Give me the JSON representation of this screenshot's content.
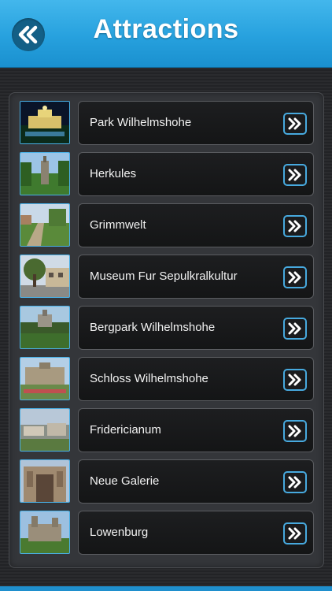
{
  "header": {
    "title": "Attractions",
    "back_icon": "double-chevron-left-icon"
  },
  "colors": {
    "header_top": "#43b7ec",
    "header_bottom": "#1a90cf",
    "accent": "#47a9de",
    "row_bg": "#17181a",
    "text": "#f2f2f2"
  },
  "items": [
    {
      "label": "Park Wilhelmshohe",
      "icon": "double-chevron-right-icon",
      "thumb": "night-palace"
    },
    {
      "label": "Herkules",
      "icon": "double-chevron-right-icon",
      "thumb": "statue-hill"
    },
    {
      "label": "Grimmwelt",
      "icon": "double-chevron-right-icon",
      "thumb": "path-lawn"
    },
    {
      "label": "Museum Fur Sepulkralkultur",
      "icon": "double-chevron-right-icon",
      "thumb": "tree-building"
    },
    {
      "label": "Bergpark Wilhelmshohe",
      "icon": "double-chevron-right-icon",
      "thumb": "castle-park"
    },
    {
      "label": "Schloss Wilhelmshohe",
      "icon": "double-chevron-right-icon",
      "thumb": "palace-garden"
    },
    {
      "label": "Fridericianum",
      "icon": "double-chevron-right-icon",
      "thumb": "city-aerial"
    },
    {
      "label": "Neue Galerie",
      "icon": "double-chevron-right-icon",
      "thumb": "gallery-facade"
    },
    {
      "label": "Lowenburg",
      "icon": "double-chevron-right-icon",
      "thumb": "castle-towers"
    }
  ]
}
